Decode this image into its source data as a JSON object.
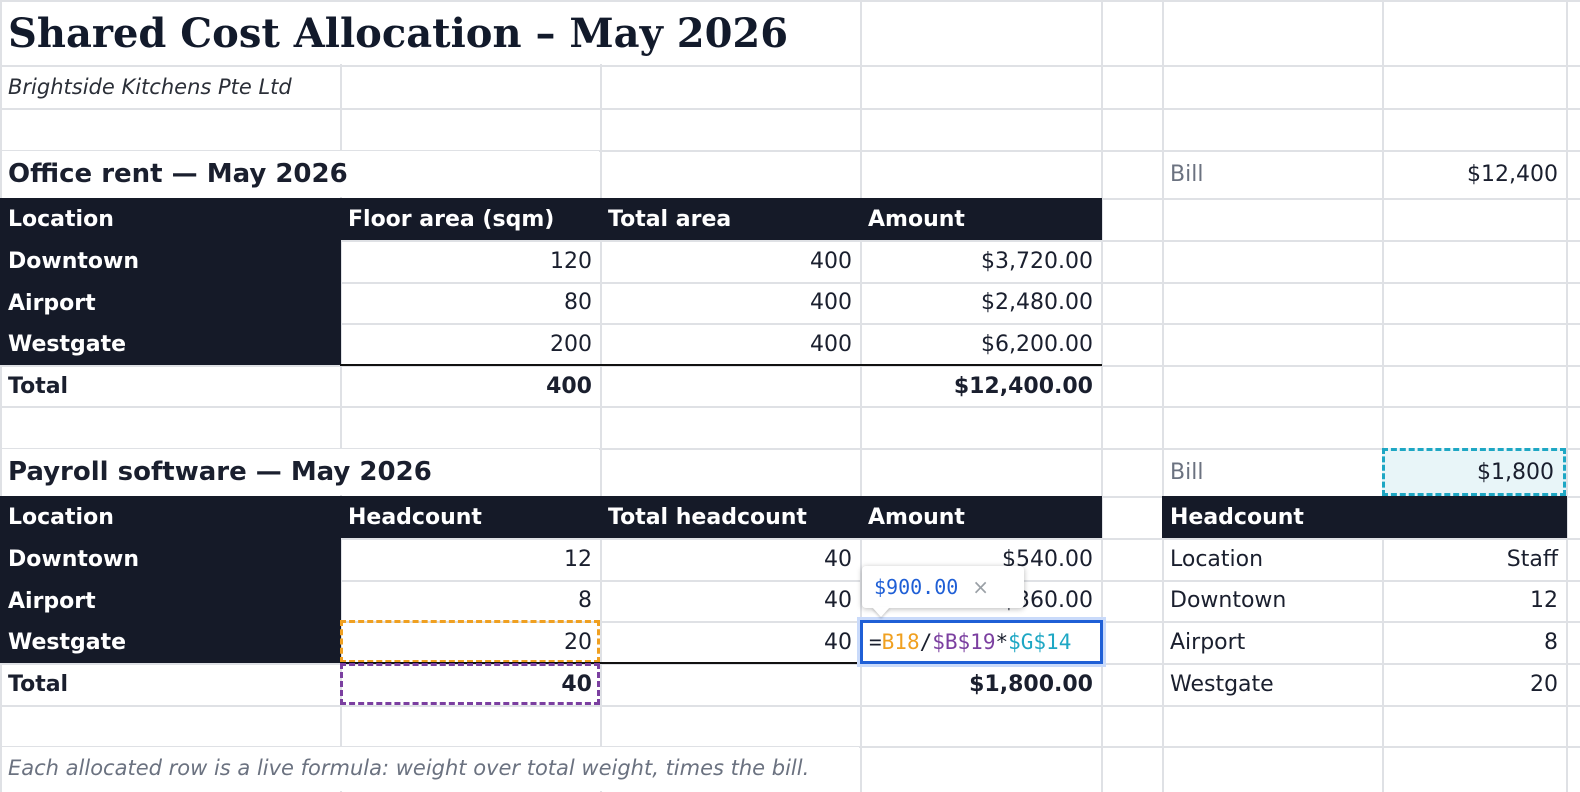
{
  "title": "Shared Cost Allocation – May 2026",
  "company": "Brightside Kitchens Pte Ltd",
  "rent": {
    "heading": "Office rent — May 2026",
    "bill_label": "Bill",
    "bill_value": "$12,400",
    "headers": [
      "Location",
      "Floor area (sqm)",
      "Total area",
      "Amount"
    ],
    "rows": [
      {
        "location": "Downtown",
        "weight": "120",
        "total": "400",
        "amount": "$3,720.00"
      },
      {
        "location": "Airport",
        "weight": "80",
        "total": "400",
        "amount": "$2,480.00"
      },
      {
        "location": "Westgate",
        "weight": "200",
        "total": "400",
        "amount": "$6,200.00"
      }
    ],
    "total_label": "Total",
    "total_weight": "400",
    "total_amount": "$12,400.00"
  },
  "payroll": {
    "heading": "Payroll software — May 2026",
    "bill_label": "Bill",
    "bill_value": "$1,800",
    "headers": [
      "Location",
      "Headcount",
      "Total headcount",
      "Amount"
    ],
    "rows": [
      {
        "location": "Downtown",
        "weight": "12",
        "total": "40",
        "amount": "$540.00"
      },
      {
        "location": "Airport",
        "weight": "8",
        "total": "40",
        "amount": "$360.00"
      },
      {
        "location": "Westgate",
        "weight": "20",
        "total": "40",
        "amount": ""
      }
    ],
    "total_label": "Total",
    "total_weight": "40",
    "total_amount": "$1,800.00"
  },
  "editor": {
    "eq": "=",
    "ref1": "B18",
    "op1": "/",
    "ref2": "$B$19",
    "op2": "*",
    "ref3": "$G$14",
    "preview_value": "$900.00",
    "preview_close": "×"
  },
  "lookup": {
    "header": "Headcount",
    "col_location": "Location",
    "col_staff": "Staff",
    "rows": [
      {
        "location": "Downtown",
        "staff": "12"
      },
      {
        "location": "Airport",
        "staff": "8"
      },
      {
        "location": "Westgate",
        "staff": "20"
      }
    ]
  },
  "note": "Each allocated row is a live formula: weight over total weight, times the bill.",
  "colors": {
    "header_bg": "#151a28",
    "editor_border": "#1f5fd6",
    "ref_orange": "#f0a020",
    "ref_purple": "#7b3fa0",
    "ref_teal": "#1ea7c4"
  }
}
